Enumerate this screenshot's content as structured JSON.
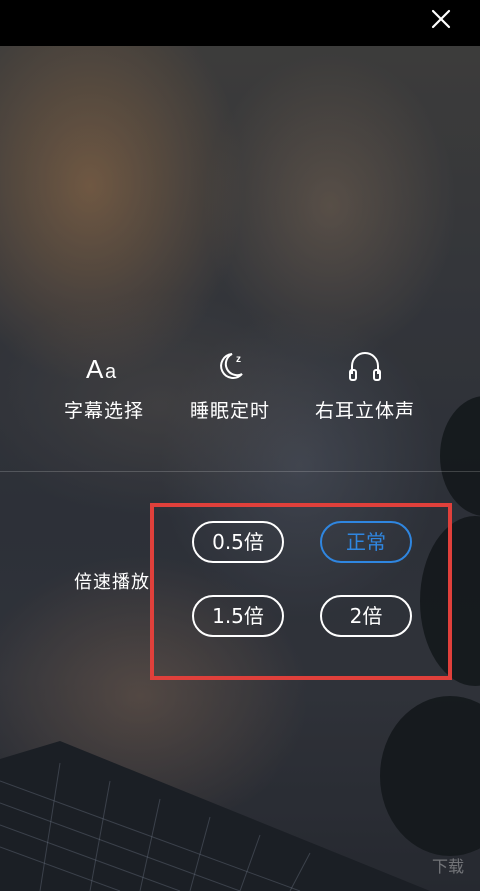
{
  "top_bar": {
    "close_icon": "close-icon"
  },
  "options": [
    {
      "id": "subtitle",
      "icon": "font-aa-icon",
      "label": "字幕选择"
    },
    {
      "id": "sleep",
      "icon": "moon-sleep-icon",
      "label": "睡眠定时"
    },
    {
      "id": "audio",
      "icon": "headphones-icon",
      "label": "右耳立体声"
    }
  ],
  "speed": {
    "label": "倍速播放",
    "options": [
      {
        "label": "0.5倍",
        "selected": false
      },
      {
        "label": "正常",
        "selected": true
      },
      {
        "label": "1.5倍",
        "selected": false
      },
      {
        "label": "2倍",
        "selected": false
      }
    ]
  },
  "colors": {
    "selected_accent": "#2f86e0",
    "highlight_box": "#e0403b"
  },
  "watermark": {
    "text": "下载"
  }
}
